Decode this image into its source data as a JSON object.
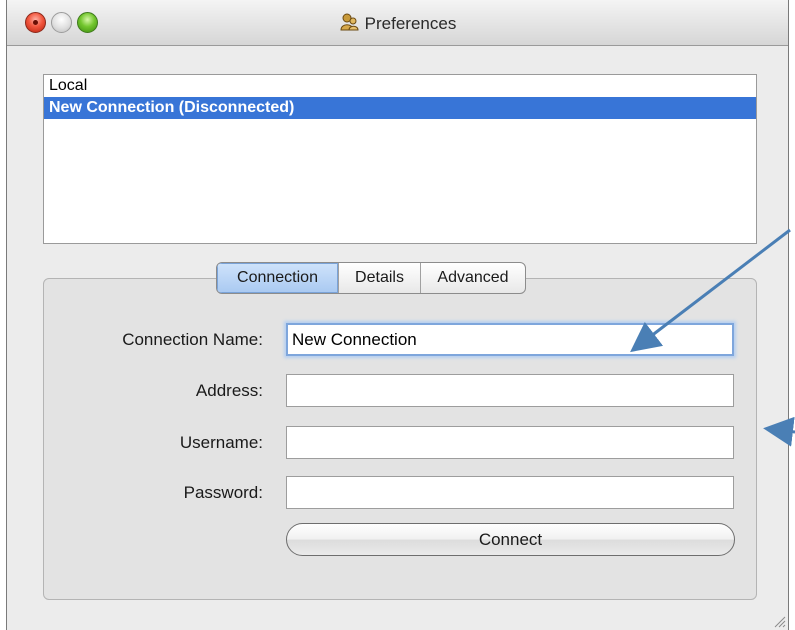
{
  "window": {
    "title": "Preferences",
    "title_icon": "users-icon"
  },
  "connections_list": {
    "items": [
      {
        "label": "Local",
        "selected": false
      },
      {
        "label": "New Connection (Disconnected)",
        "selected": true
      }
    ]
  },
  "tabs": [
    {
      "label": "Connection",
      "active": true
    },
    {
      "label": "Details",
      "active": false
    },
    {
      "label": "Advanced",
      "active": false
    }
  ],
  "form": {
    "connection_name": {
      "label": "Connection Name:",
      "value": "New Connection"
    },
    "address": {
      "label": "Address:",
      "value": ""
    },
    "username": {
      "label": "Username:",
      "value": ""
    },
    "password": {
      "label": "Password:",
      "value": ""
    },
    "connect_label": "Connect"
  },
  "colors": {
    "selection": "#3875d7",
    "annotation_arrow": "#4a7fb5",
    "focus_ring": "#7ea6dc"
  }
}
